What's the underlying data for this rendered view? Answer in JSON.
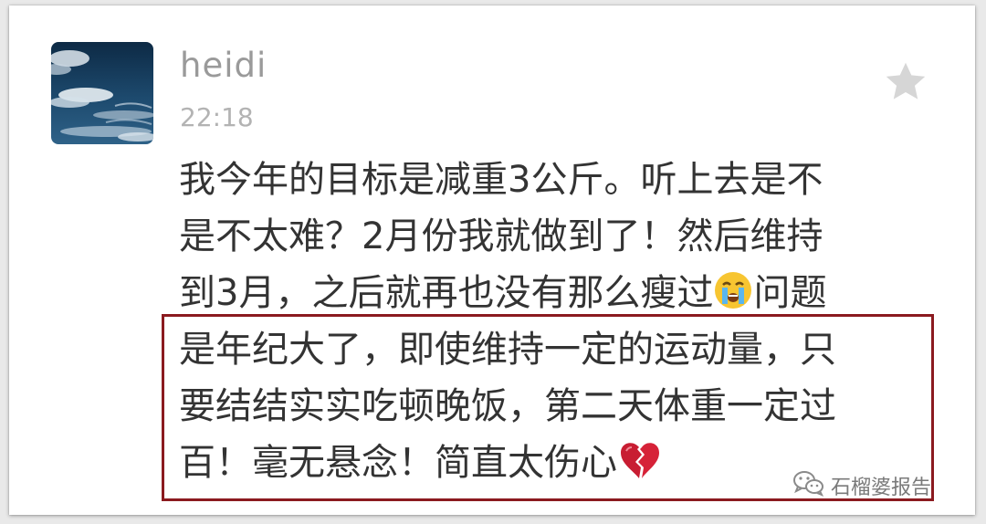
{
  "post": {
    "username": "heidi",
    "time": "22:18",
    "lines": [
      "我今年的目标是减重3公斤。听上去是不",
      "是不太难？2月份我就做到了！然后维持",
      "到3月，之后就再也没有那么瘦过",
      "问题",
      "是年纪大了，即使维持一定的运动量，只",
      "要结结实实吃顿晚饭，第二天体重一定过",
      "百！毫无悬念！简直太伤心"
    ],
    "emoji": {
      "crying": "crying-face-emoji",
      "broken_heart": "broken-heart-emoji"
    }
  },
  "watermark": {
    "text": "石榴婆报告",
    "icon": "wechat-icon"
  },
  "colors": {
    "highlight_border": "#8b1a1f",
    "username": "#9a9a9a",
    "time": "#b3b3b3",
    "text": "#333333",
    "star": "#d6d6d6"
  }
}
